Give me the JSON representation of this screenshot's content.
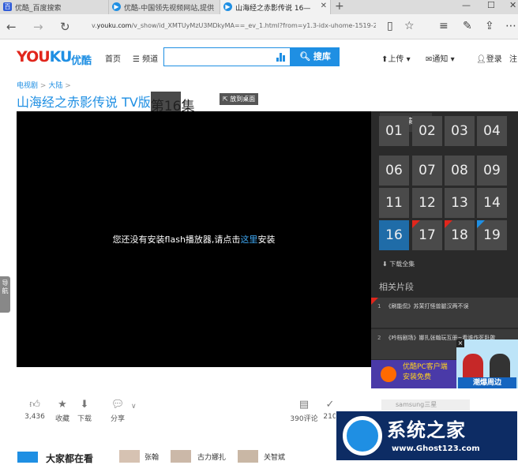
{
  "browser": {
    "tabs": [
      {
        "label": "优酷_百度搜索",
        "active": false
      },
      {
        "label": "优酷-中国领先视频网站,提供",
        "active": false
      },
      {
        "label": "山海经之赤影传说 16—",
        "active": true
      }
    ],
    "url_prefix": "v.",
    "url_domain": "youku.com",
    "url_rest": "/v_show/id_XMTUyMzU3MDkyMA==_ev_1.html?from=y1.3-idx-uhome-1519-2"
  },
  "header": {
    "logo_latin_you": "YOU",
    "logo_latin_ku": "KU",
    "logo_cn": "优酷",
    "nav_home": "首页",
    "nav_channels": "频道",
    "search_placeholder": "",
    "search_button": "搜库",
    "upload": "上传",
    "notify": "通知",
    "login": "登录",
    "register": "注"
  },
  "breadcrumb": {
    "level1": "电视剧",
    "level2": "大陆",
    "sep": ">"
  },
  "title": {
    "show": "山海经之赤影传说 TV版",
    "colon": "：",
    "episode": "第16集",
    "desktop_badge": "放到桌面"
  },
  "player": {
    "msg_before": "您还没有安装flash播放器,请点击",
    "msg_link": "这里",
    "msg_after": "安装"
  },
  "side_guide": "导航",
  "episodes": {
    "tab": "选集",
    "items": [
      "01",
      "02",
      "03",
      "04",
      "06",
      "07",
      "08",
      "09",
      "11",
      "12",
      "13",
      "14",
      "16",
      "17",
      "18",
      "19"
    ],
    "current": "16",
    "download_all": "下载全集",
    "related_title": "相关片段",
    "related": [
      {
        "num": "1",
        "text": "《刷能侃》苏茉打怪兽腿汉两不误"
      },
      {
        "num": "2",
        "text": "《吟档剧场》娜扎张翰玩互册~看谁作死卧敢"
      }
    ]
  },
  "ad": {
    "line1": "优酷PC客户端",
    "line2": "安装免费",
    "corner": "潮爆周边",
    "close": "×"
  },
  "actions": {
    "likes": "3,436",
    "collect": "收藏",
    "download": "下载",
    "share": "分享",
    "comments": "390评论",
    "other": "210"
  },
  "search_suggest": "samsung三星",
  "bottom_row": {
    "heading": "大家都在看",
    "names": [
      "张翰",
      "古力娜扎",
      "关智斌"
    ]
  },
  "watermark": {
    "title": "系统之家",
    "url": "www.Ghost123.com"
  },
  "colors": {
    "brand_blue": "#1f8fe3",
    "brand_red": "#e1261c",
    "player_bg": "#000000"
  }
}
